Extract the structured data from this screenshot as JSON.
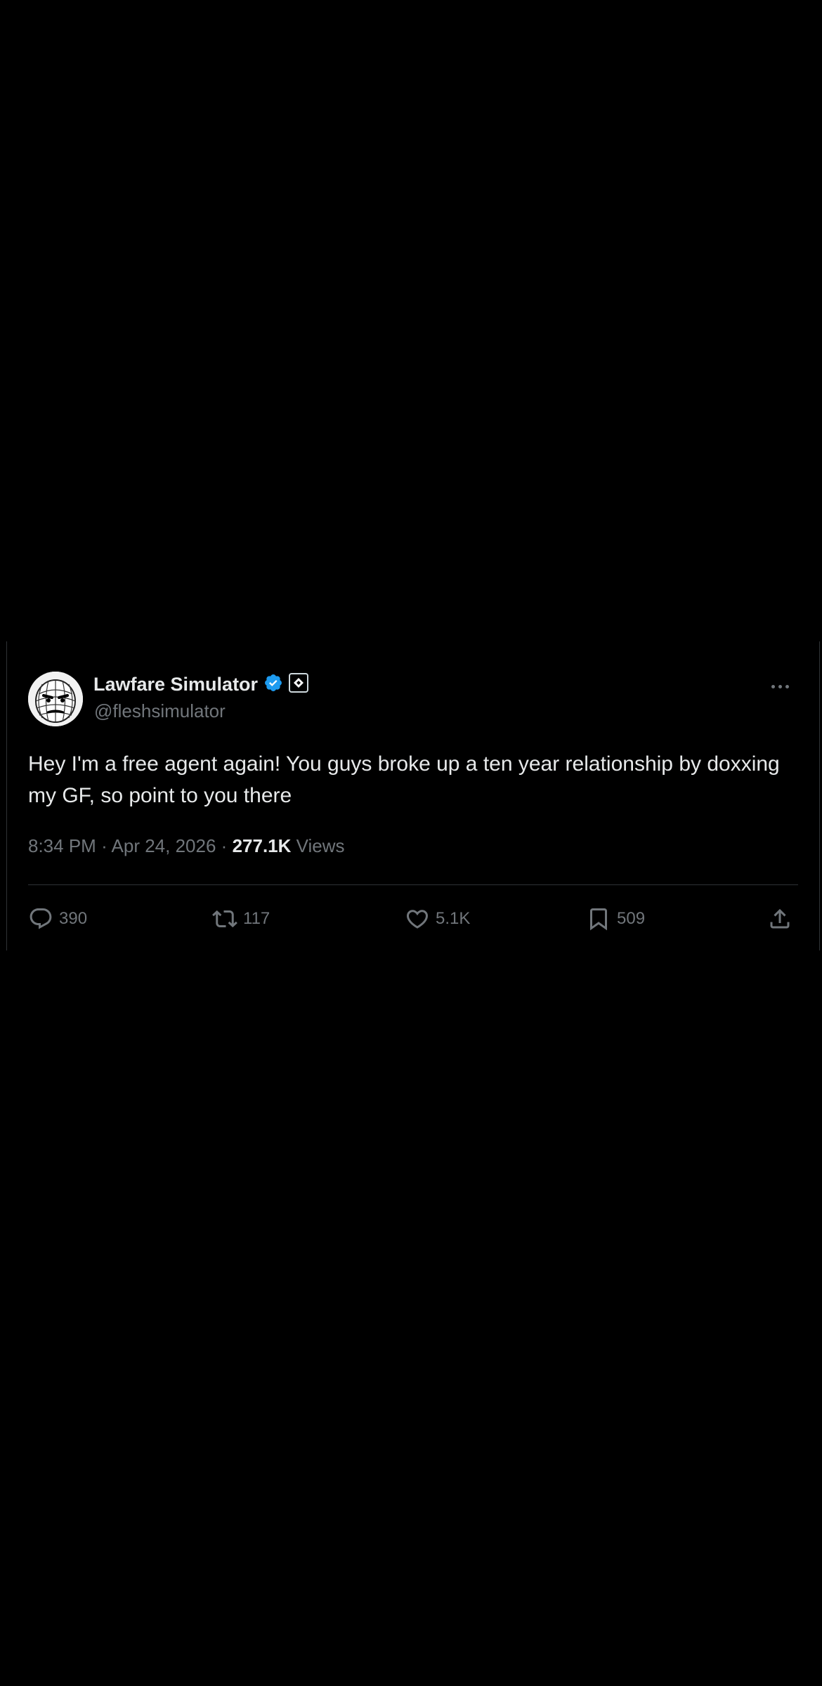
{
  "tweet": {
    "display_name": "Lawfare Simulator",
    "handle": "@fleshsimulator",
    "avatar_icon": "grid-face-avatar",
    "verified_icon": "verified-badge-icon",
    "affiliate_icon": "affiliate-badge-icon",
    "more_icon": "more-options-icon",
    "text": "Hey I'm a free agent again! You guys broke up a ten year relationship by doxxing my GF, so point to you there",
    "time": "8:34 PM",
    "separator": "·",
    "date": "Apr 24, 2026",
    "views_count": "277.1K",
    "views_label": "Views"
  },
  "actions": {
    "reply": {
      "icon": "reply-icon",
      "count": "390"
    },
    "repost": {
      "icon": "repost-icon",
      "count": "117"
    },
    "like": {
      "icon": "heart-icon",
      "count": "5.1K"
    },
    "bookmark": {
      "icon": "bookmark-icon",
      "count": "509"
    },
    "share": {
      "icon": "share-icon"
    }
  },
  "colors": {
    "background": "#000000",
    "text_primary": "#e7e9ea",
    "text_secondary": "#71767b",
    "border": "#2f3336",
    "verified_blue": "#1d9bf0"
  }
}
